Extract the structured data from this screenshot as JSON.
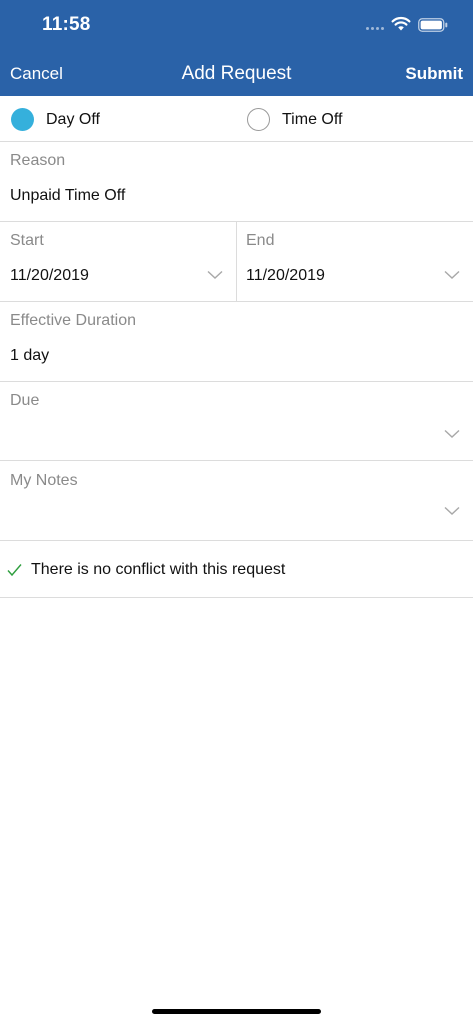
{
  "status_bar": {
    "time": "11:58"
  },
  "nav": {
    "cancel": "Cancel",
    "title": "Add Request",
    "submit": "Submit"
  },
  "type_options": [
    {
      "label": "Day Off",
      "selected": true
    },
    {
      "label": "Time Off",
      "selected": false
    }
  ],
  "fields": {
    "reason": {
      "label": "Reason",
      "value": "Unpaid Time Off"
    },
    "start": {
      "label": "Start",
      "value": "11/20/2019"
    },
    "end": {
      "label": "End",
      "value": "11/20/2019"
    },
    "effective_duration": {
      "label": "Effective Duration",
      "value": "1 day"
    },
    "due": {
      "label": "Due",
      "value": ""
    },
    "notes": {
      "label": "My Notes",
      "value": ""
    }
  },
  "conflict_message": "There is no conflict with this request",
  "colors": {
    "header": "#2a62a8",
    "radio_selected": "#35b0dc",
    "check": "#2e9e3e"
  }
}
